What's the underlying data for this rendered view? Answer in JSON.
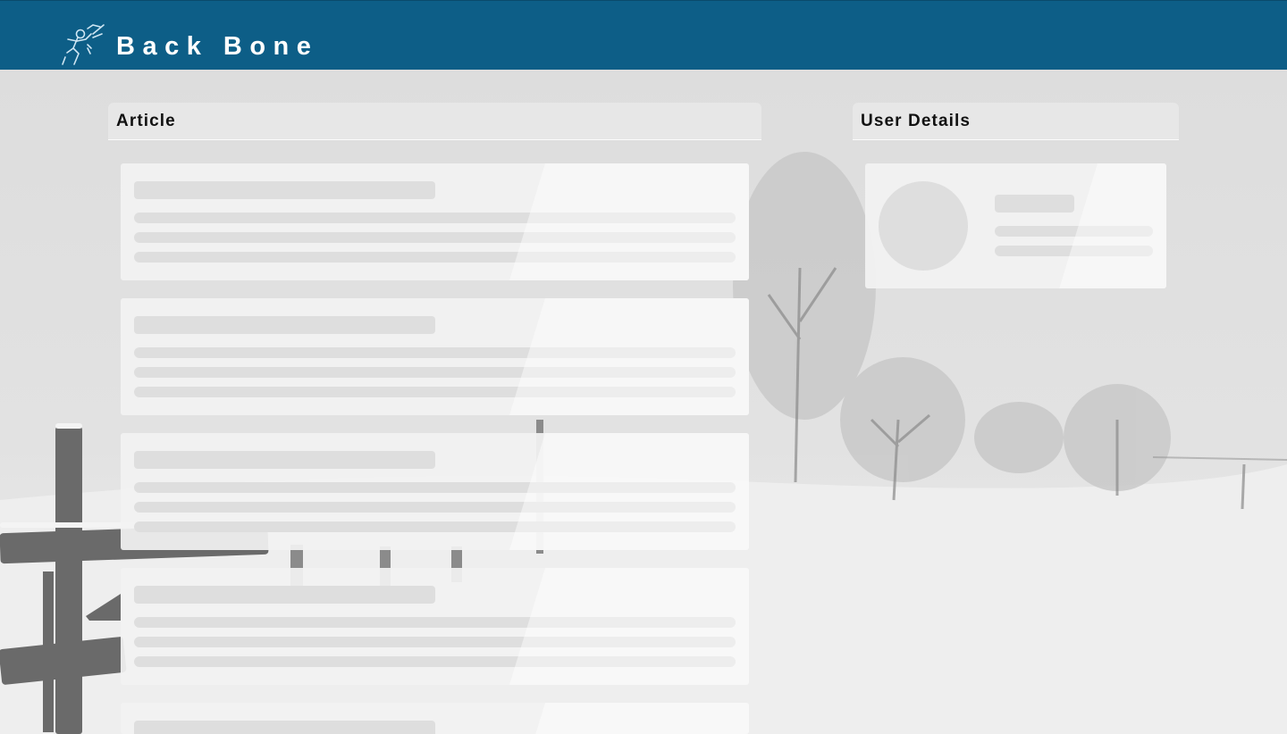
{
  "header": {
    "brand": "Back Bone",
    "logo_icon": "running-figure-icon",
    "background_color": "#0d5e87"
  },
  "sections": {
    "article": {
      "title": "Article"
    },
    "user_details": {
      "title": "User Details"
    }
  },
  "article_skeletons": [
    {
      "state": "loading"
    },
    {
      "state": "loading"
    },
    {
      "state": "loading"
    },
    {
      "state": "loading"
    },
    {
      "state": "loading"
    }
  ],
  "user_skeleton": {
    "state": "loading"
  },
  "background": {
    "image": "snowy-landscape"
  }
}
